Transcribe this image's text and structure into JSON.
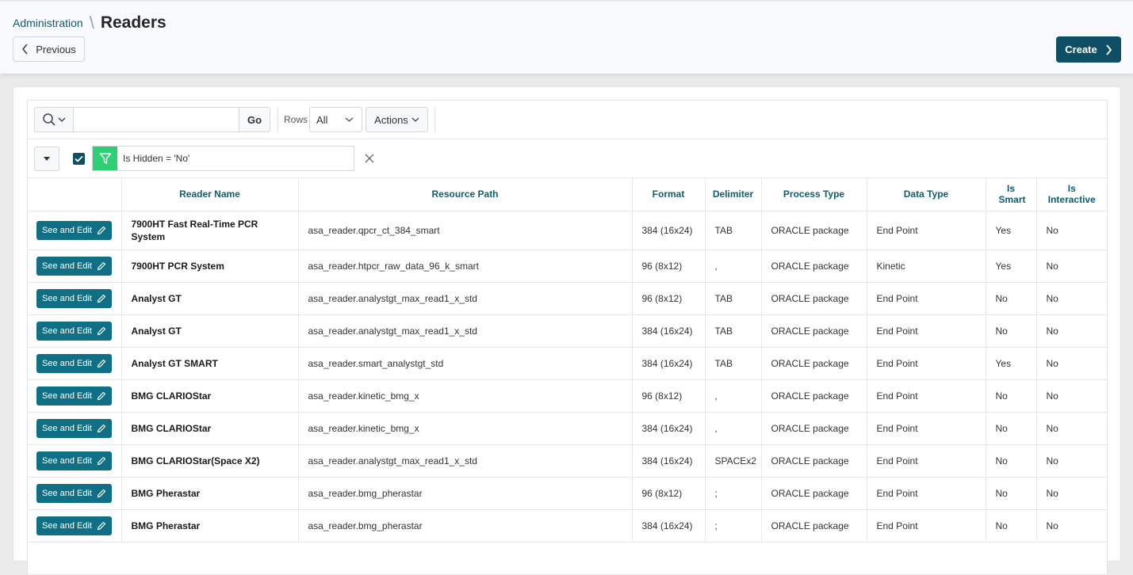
{
  "breadcrumb": {
    "parent": "Administration",
    "title": "Readers"
  },
  "header": {
    "previous_label": "Previous",
    "create_label": "Create"
  },
  "toolbar": {
    "search_value": "",
    "go_label": "Go",
    "rows_label": "Rows",
    "rows_value": "All",
    "actions_label": "Actions"
  },
  "filter": {
    "text": "Is Hidden = 'No'",
    "enabled": true
  },
  "colors": {
    "primary": "#0e4f66",
    "edit_button": "#0e6f85",
    "filter_green": "#2fcf75",
    "header_text": "#0c5d73"
  },
  "table": {
    "columns": [
      "",
      "Reader Name",
      "Resource Path",
      "Format",
      "Delimiter",
      "Process Type",
      "Data Type",
      "Is Smart",
      "Is Interactive"
    ],
    "edit_label": "See and Edit",
    "rows": [
      {
        "name": "7900HT Fast Real-Time PCR System",
        "path": "asa_reader.qpcr_ct_384_smart",
        "format": "384 (16x24)",
        "delimiter": "TAB",
        "process": "ORACLE package",
        "dtype": "End Point",
        "smart": "Yes",
        "interactive": "No"
      },
      {
        "name": "7900HT PCR System",
        "path": "asa_reader.htpcr_raw_data_96_k_smart",
        "format": "96 (8x12)",
        "delimiter": ",",
        "process": "ORACLE package",
        "dtype": "Kinetic",
        "smart": "Yes",
        "interactive": "No"
      },
      {
        "name": "Analyst GT",
        "path": "asa_reader.analystgt_max_read1_x_std",
        "format": "96 (8x12)",
        "delimiter": "TAB",
        "process": "ORACLE package",
        "dtype": "End Point",
        "smart": "No",
        "interactive": "No"
      },
      {
        "name": "Analyst GT",
        "path": "asa_reader.analystgt_max_read1_x_std",
        "format": "384 (16x24)",
        "delimiter": "TAB",
        "process": "ORACLE package",
        "dtype": "End Point",
        "smart": "No",
        "interactive": "No"
      },
      {
        "name": "Analyst GT SMART",
        "path": "asa_reader.smart_analystgt_std",
        "format": "384 (16x24)",
        "delimiter": "TAB",
        "process": "ORACLE package",
        "dtype": "End Point",
        "smart": "Yes",
        "interactive": "No"
      },
      {
        "name": "BMG CLARIOStar",
        "path": "asa_reader.kinetic_bmg_x",
        "format": "96 (8x12)",
        "delimiter": ",",
        "process": "ORACLE package",
        "dtype": "End Point",
        "smart": "No",
        "interactive": "No"
      },
      {
        "name": "BMG CLARIOStar",
        "path": "asa_reader.kinetic_bmg_x",
        "format": "384 (16x24)",
        "delimiter": ",",
        "process": "ORACLE package",
        "dtype": "End Point",
        "smart": "No",
        "interactive": "No"
      },
      {
        "name": "BMG CLARIOStar(Space X2)",
        "path": "asa_reader.analystgt_max_read1_x_std",
        "format": "384 (16x24)",
        "delimiter": "SPACEx2",
        "process": "ORACLE package",
        "dtype": "End Point",
        "smart": "No",
        "interactive": "No"
      },
      {
        "name": "BMG Pherastar",
        "path": "asa_reader.bmg_pherastar",
        "format": "96 (8x12)",
        "delimiter": ";",
        "process": "ORACLE package",
        "dtype": "End Point",
        "smart": "No",
        "interactive": "No"
      },
      {
        "name": "BMG Pherastar",
        "path": "asa_reader.bmg_pherastar",
        "format": "384 (16x24)",
        "delimiter": ";",
        "process": "ORACLE package",
        "dtype": "End Point",
        "smart": "No",
        "interactive": "No"
      }
    ]
  }
}
